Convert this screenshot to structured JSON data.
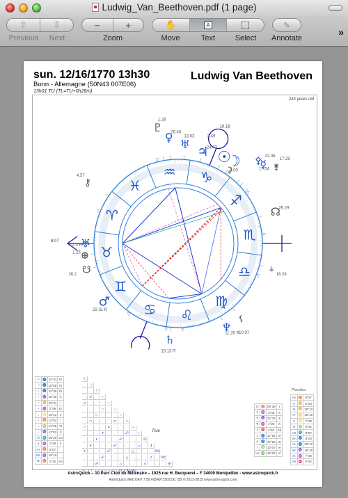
{
  "window": {
    "title": "Ludwig_Van_Beethoven.pdf (1 page)"
  },
  "toolbar": {
    "previous_label": "Previous",
    "next_label": "Next",
    "zoom_label": "Zoom",
    "zoom_out_glyph": "−",
    "zoom_in_glyph": "+",
    "move_label": "Move",
    "text_label": "Text",
    "select_label": "Select",
    "annotate_label": "Annotate",
    "overflow_glyph": "»",
    "active_tool": "Text"
  },
  "chart_page": {
    "date_time": "sun. 12/16/1770 13h30",
    "place": "Bonn - Allemagne (50N43 007E06)",
    "tu": "13h01 TU (TL=TU+0h28m)",
    "name": "Ludwig Van Beethoven",
    "age": "244 years old",
    "colors": {
      "wheel": "#2f7fd8",
      "planet": "#1f56c8",
      "secondary": "#555555",
      "asc_line": "#1c1c9a"
    },
    "signs": [
      "♈",
      "♉",
      "♊",
      "♋",
      "♌",
      "♍",
      "♎",
      "♏",
      "♐",
      "♑",
      "♒",
      "♓"
    ],
    "axes": {
      "asc_label": "8.07",
      "mc_label": "16.18"
    },
    "planets": [
      {
        "name": "Sun",
        "glyph": "☉",
        "label": "24.43"
      },
      {
        "name": "Moon",
        "glyph": "☽",
        "label": ""
      },
      {
        "name": "Mercury",
        "glyph": "☿",
        "label": "22.36"
      },
      {
        "name": "Venus",
        "glyph": "♀",
        "label": "26.46"
      },
      {
        "name": "Mars",
        "glyph": "♂",
        "label": "22.31 R"
      },
      {
        "name": "Jupiter",
        "glyph": "♃",
        "label": "3.49"
      },
      {
        "name": "Saturn",
        "glyph": "♄",
        "label": "15.13 R"
      },
      {
        "name": "Uranus",
        "glyph": "♅",
        "label": "12.0 R"
      },
      {
        "name": "Neptune",
        "glyph": "♆",
        "label": "11.26 R"
      },
      {
        "name": "Pluto",
        "glyph": "♇",
        "label": "1.28"
      },
      {
        "name": "Node",
        "glyph": "☊",
        "label": "26.29"
      },
      {
        "name": "South Node",
        "glyph": "☋",
        "label": "26.2"
      },
      {
        "name": "Part of Fortune",
        "glyph": "⊕",
        "label": "1.25"
      },
      {
        "name": "Chiron",
        "glyph": "⚷",
        "label": "4.57"
      },
      {
        "name": "Uranus 2",
        "glyph": "♅",
        "label": "13.03"
      },
      {
        "name": "Ceres",
        "glyph": "⚳",
        "label": "9.00"
      },
      {
        "name": "Pallas",
        "glyph": "⚴",
        "label": "17.54"
      },
      {
        "name": "Juno",
        "glyph": "⚵",
        "label": "17.28"
      },
      {
        "name": "Vesta",
        "glyph": "⚶",
        "label": "16.26"
      },
      {
        "name": "Lilith",
        "glyph": "⚸",
        "label": "10.07"
      }
    ],
    "positions_table": [
      [
        "☉",
        "♐",
        "24°43",
        "IX"
      ],
      [
        "☽",
        "♐",
        "18°55",
        "IX"
      ],
      [
        "☿",
        "♐",
        "22°36",
        "IX"
      ],
      [
        "♀",
        "♑",
        "26°46",
        "X"
      ],
      [
        "♂",
        "♊",
        "22°31",
        "I"
      ],
      [
        "♃",
        "♑",
        "3°49",
        "IX"
      ],
      [
        "♄",
        "♌",
        "15°13",
        "V"
      ],
      [
        "♅",
        "♉",
        "12°04",
        "I"
      ],
      [
        "♆",
        "♍",
        "11°26",
        "VI"
      ],
      [
        "♇",
        "♑",
        "13°03",
        "X"
      ],
      [
        "☊",
        "♏",
        "26°29",
        "VII"
      ],
      [
        "⚷",
        "♒",
        "1°28",
        "X"
      ],
      [
        "As",
        "♉",
        "8°07",
        ""
      ],
      [
        "Mc",
        "♑",
        "16°18",
        ""
      ],
      [
        "⊕",
        "♉",
        "1°25",
        "XII"
      ]
    ],
    "aspect_grid_footer": "☉ ☽ ☿ ♀ ♂ ♃ ♄ ♅ ♆ ♇ ☊ ⚷ As Mc",
    "true_label": "True",
    "asteroids_table": [
      [
        "☋",
        "♉",
        "26°29",
        "I"
      ],
      [
        "⚳",
        "♒",
        "3°45",
        "X"
      ],
      [
        "⚴",
        "♑",
        "22°37",
        "X"
      ],
      [
        "⚵",
        "♒",
        "1°28",
        "X"
      ],
      [
        "⚷",
        "♈",
        "4°57",
        "XII"
      ],
      [
        "⚸",
        "♐",
        "17°54",
        "IX"
      ],
      [
        "⚶",
        "♐",
        "17°28",
        "IX"
      ],
      [
        "♁",
        "♍",
        "10°07",
        "VI"
      ],
      [
        "Vx",
        "♎",
        "16°26",
        "VI"
      ]
    ],
    "houses_title": "Placidus",
    "houses_table": [
      [
        "As",
        "♉",
        "8°07"
      ],
      [
        "II",
        "♊",
        "8°23"
      ],
      [
        "III",
        "♊",
        "29°12"
      ],
      [
        "IV",
        "♋",
        "16°18"
      ],
      [
        "V",
        "♌",
        "7°28"
      ],
      [
        "VI",
        "♍",
        "9°32"
      ],
      [
        "VII",
        "♏",
        "8°07"
      ],
      [
        "VIII",
        "♐",
        "8°23"
      ],
      [
        "IX",
        "♐",
        "29°12"
      ],
      [
        "Mc",
        "♑",
        "16°18"
      ],
      [
        "XI",
        "♒",
        "7°28"
      ],
      [
        "XII",
        "♓",
        "9°32"
      ]
    ],
    "footer_line1": "AstroQuick – 10 Parc Club du Millénaire – 1025 rue H. Becquerel – F 34000 Montpellier - www.astroquick.fr",
    "footer_line2": "AstroQuick Web DEV 7.50 #d5497150219​1725 © 2013-2015 www.astro-quick.com"
  }
}
